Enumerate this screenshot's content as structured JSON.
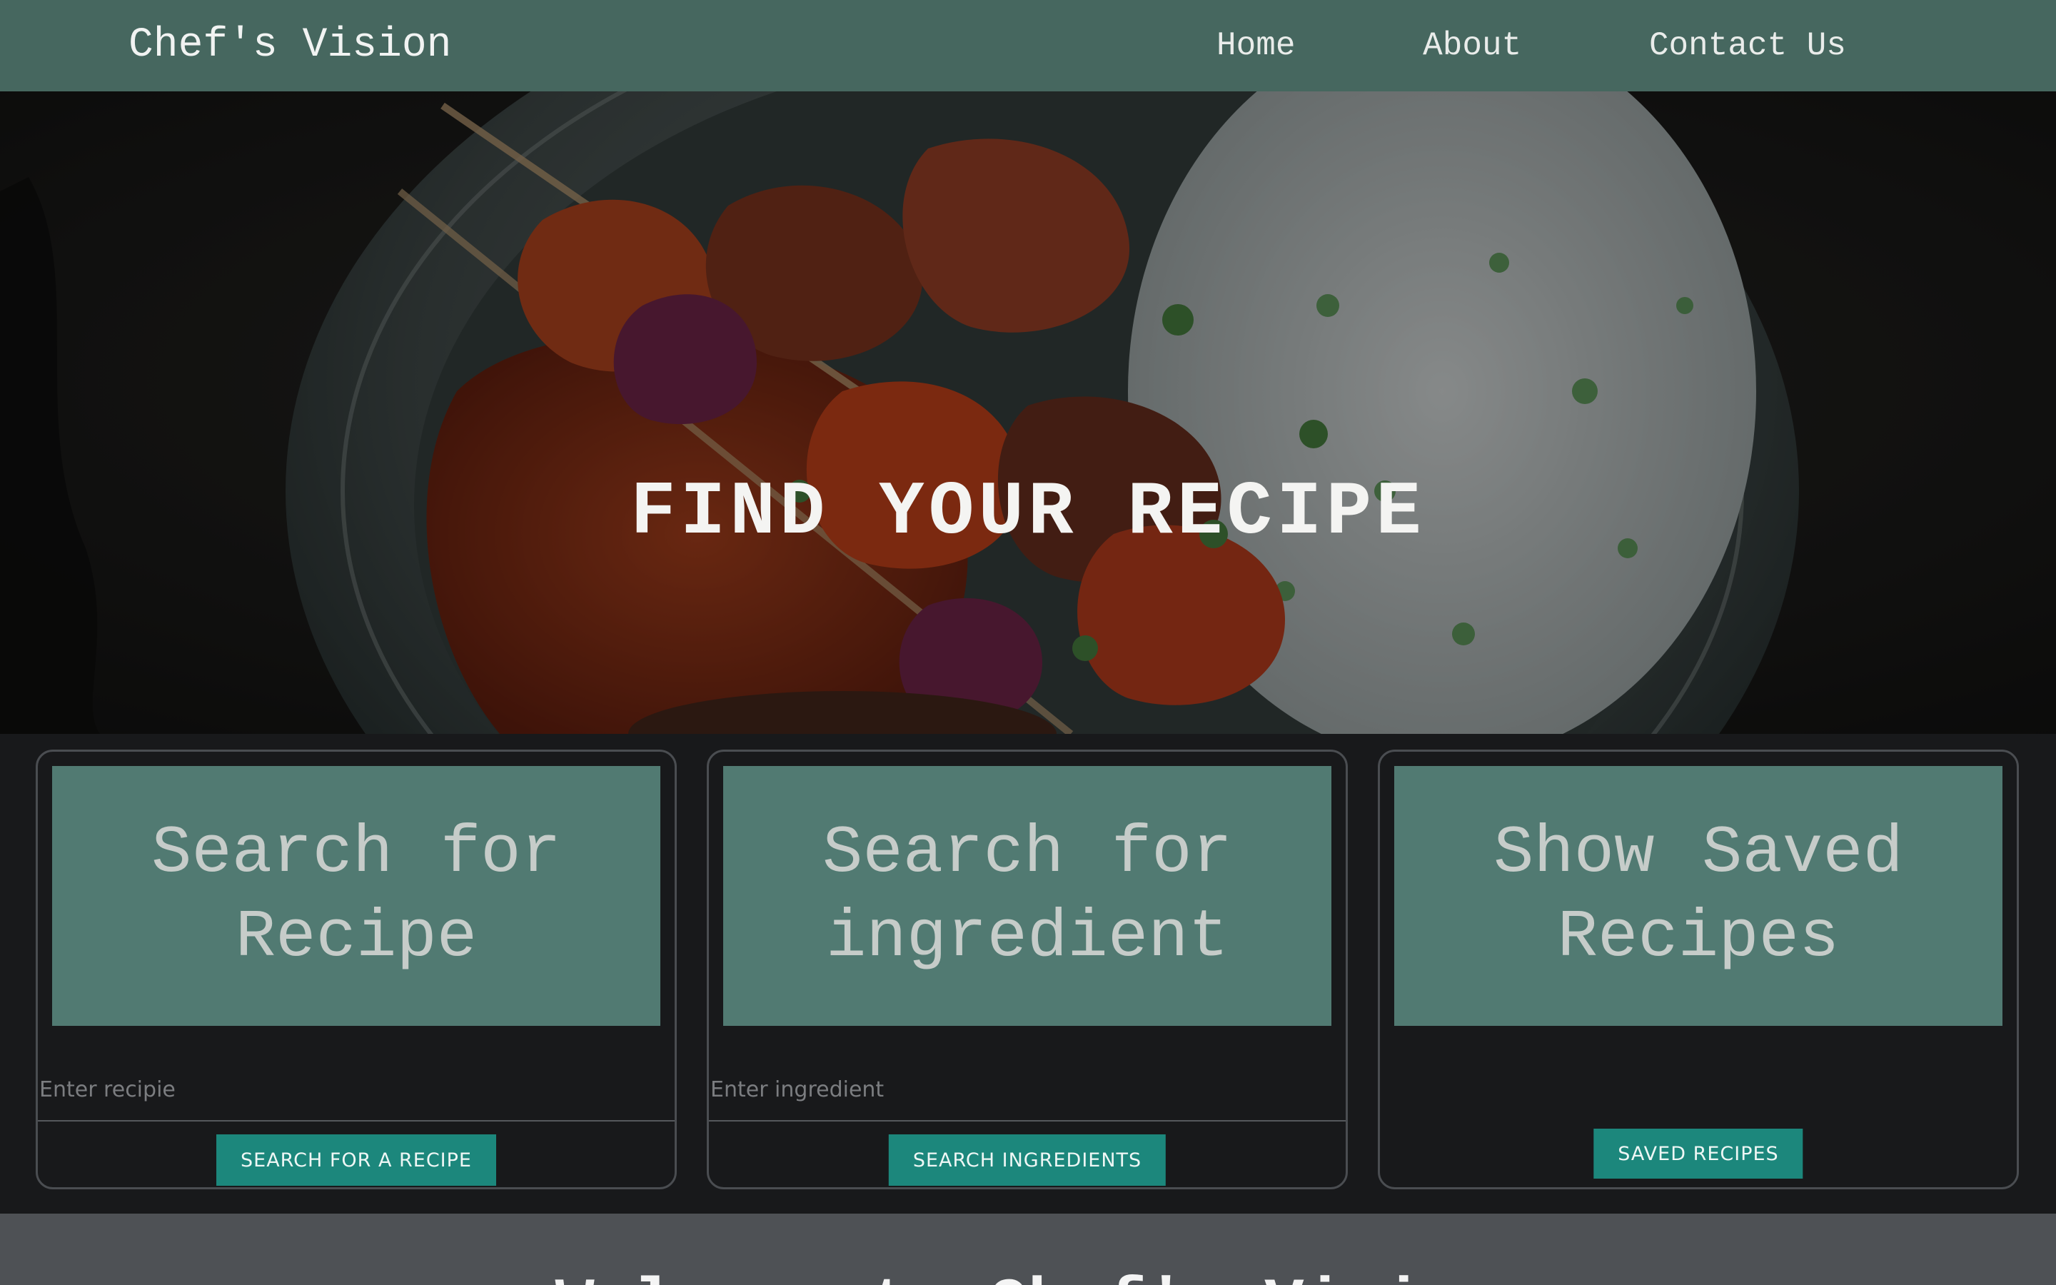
{
  "navbar": {
    "brand": "Chef's Vision",
    "links": [
      {
        "label": "Home"
      },
      {
        "label": "About"
      },
      {
        "label": "Contact Us"
      }
    ]
  },
  "hero": {
    "title": "FIND YOUR RECIPE",
    "image_icon": "food-plate-photo"
  },
  "cards": [
    {
      "title": "Search for Recipe",
      "input_placeholder": "Enter recipie",
      "button_label": "SEARCH FOR A RECIPE"
    },
    {
      "title": "Search for ingredient",
      "input_placeholder": "Enter ingredient",
      "button_label": "SEARCH INGREDIENTS"
    },
    {
      "title": "Show Saved Recipes",
      "button_label": "SAVED RECIPES"
    }
  ],
  "welcome": {
    "title": "Welcome to Chef's Vision"
  },
  "colors": {
    "navbar_bg": "#46675f",
    "card_header_bg": "#517a72",
    "button_bg": "#1c877c",
    "page_bg": "#18191b",
    "welcome_bg": "#4e5155"
  }
}
